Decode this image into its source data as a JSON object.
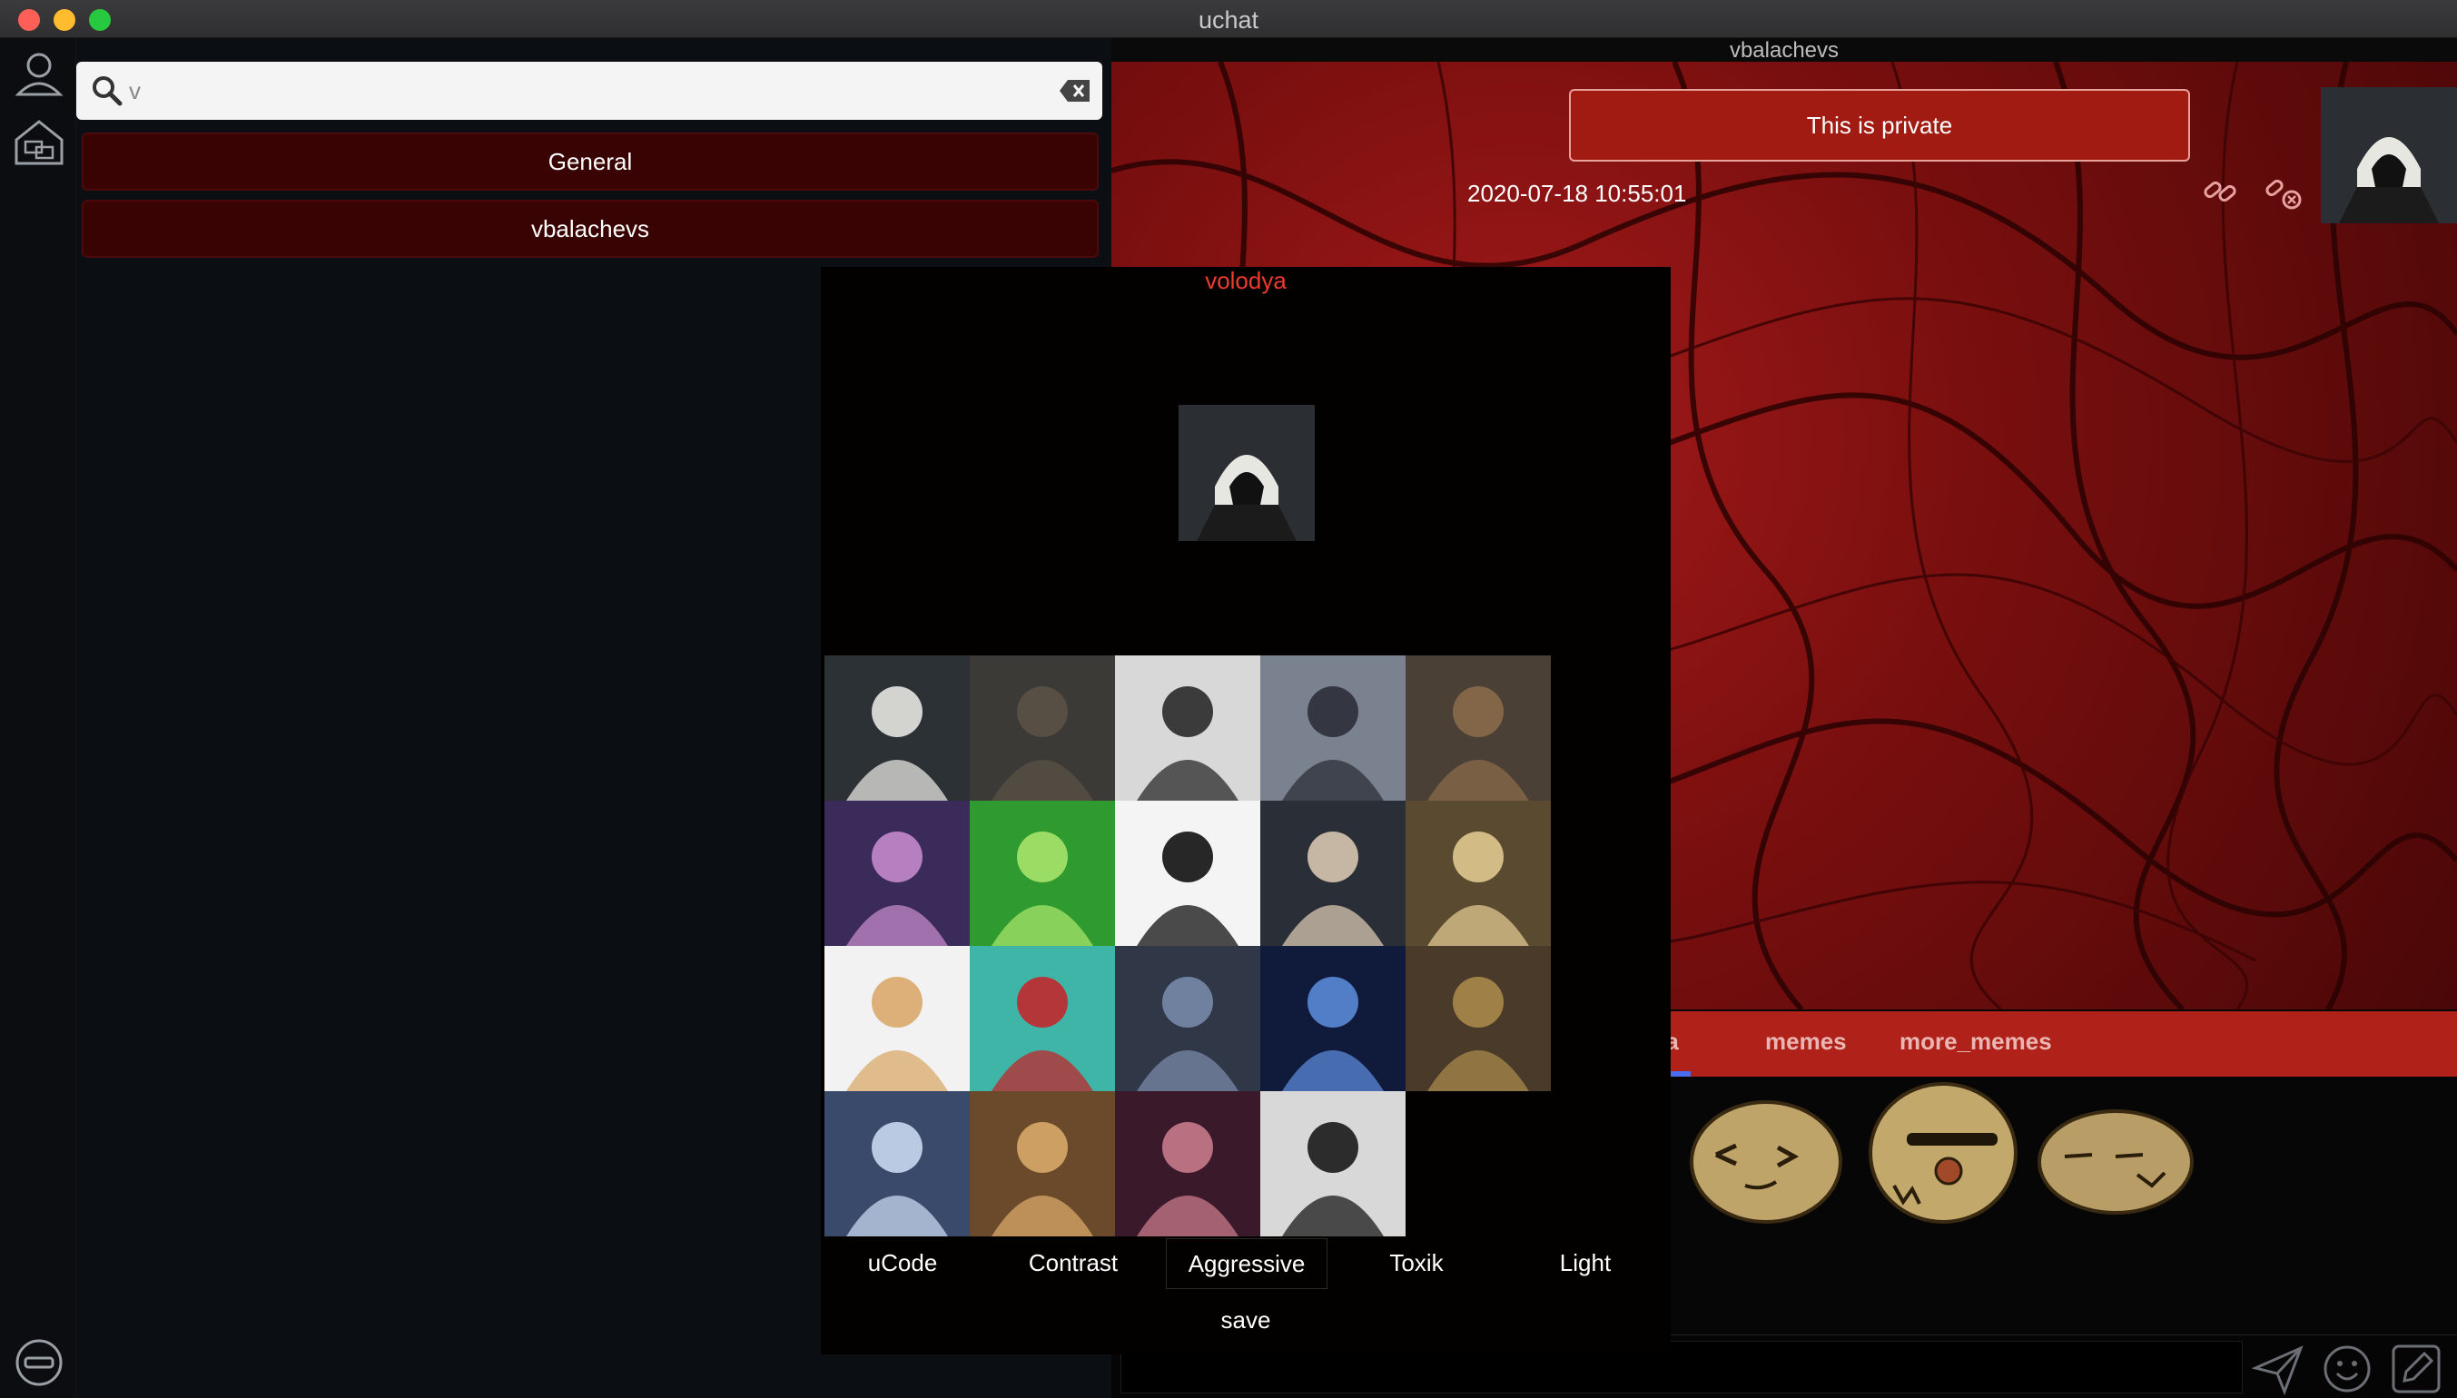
{
  "window": {
    "title": "uchat"
  },
  "sidebar": {
    "search": {
      "value": "v",
      "placeholder": ""
    },
    "rooms": [
      {
        "label": "General"
      },
      {
        "label": "vbalachevs"
      }
    ]
  },
  "chat": {
    "name": "vbalachevs",
    "message": {
      "text": "This is private",
      "timestamp": "2020-07-18 10:55:01"
    },
    "sticker_tabs": [
      {
        "label": "nka"
      },
      {
        "label": "memes"
      },
      {
        "label": "more_memes"
      }
    ]
  },
  "profile": {
    "username": "volodya",
    "avatar_icons": [
      "hooded-assassin-avatar",
      "warrior-woman-avatar",
      "horned-demon-avatar",
      "armored-knight-woman-avatar",
      "helmeted-soldier-avatar",
      "purple-hair-woman-avatar",
      "cartoon-hulk-avatar",
      "monocle-meme-avatar",
      "angel-dancer-avatar",
      "old-wizard-avatar",
      "blonde-fighter-avatar",
      "cartoon-superman-avatar",
      "dark-angel-avatar",
      "blue-wraith-avatar",
      "orc-warrior-avatar",
      "cartoon-batman-avatar",
      "boromir-meme-avatar",
      "winged-succubus-avatar",
      "man-in-hat-avatar"
    ],
    "themes": [
      "uCode",
      "Contrast",
      "Aggressive",
      "Toxik",
      "Light"
    ],
    "selected_theme": "Aggressive",
    "save_label": "save"
  },
  "colors": {
    "room_button": "#3a0303",
    "private_bubble": "#a11b13",
    "sticker_bar": "#b0211a",
    "username": "#f03a2e",
    "tab_underline": "#4a6df0"
  }
}
